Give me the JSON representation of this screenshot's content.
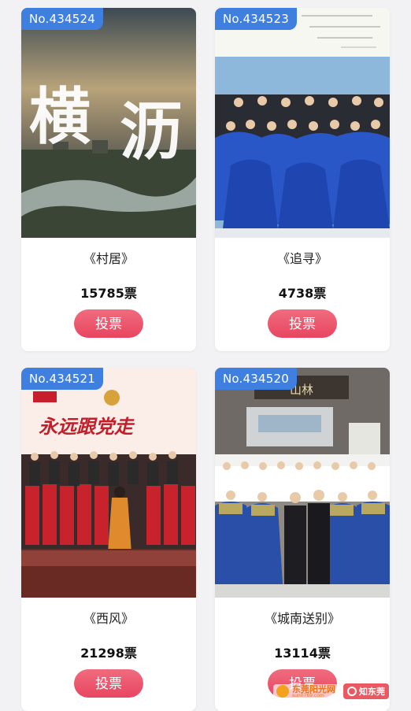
{
  "entries": [
    {
      "number": "No.434524",
      "title": "《村居》",
      "votes": "15785票",
      "vote_label": "投票"
    },
    {
      "number": "No.434523",
      "title": "《追寻》",
      "votes": "4738票",
      "vote_label": "投票"
    },
    {
      "number": "No.434521",
      "title": "《西风》",
      "votes": "21298票",
      "vote_label": "投票"
    },
    {
      "number": "No.434520",
      "title": "《城南送别》",
      "votes": "13114票",
      "vote_label": "投票"
    }
  ],
  "watermark": {
    "sun_title": "东莞阳光网",
    "sun_url": "sun0769.com",
    "zdg_label": "知东莞"
  },
  "colors": {
    "badge": "#3f7fe0",
    "vote_button": "#e84560",
    "background": "#f2f2f4"
  }
}
